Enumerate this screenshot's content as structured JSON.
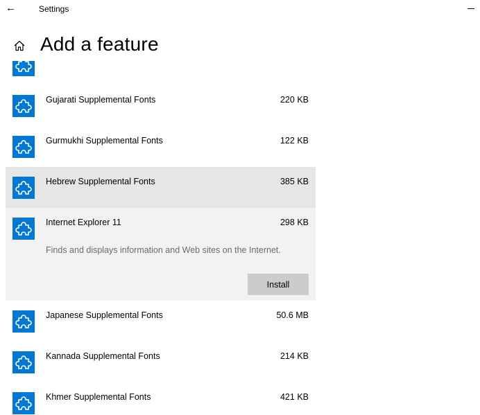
{
  "window": {
    "title": "Settings",
    "back_icon": "arrow-left-icon",
    "minimize_icon": "minimize-icon"
  },
  "page": {
    "title": "Add a feature",
    "home_icon": "home-icon"
  },
  "colors": {
    "accent": "#0078d4",
    "hover_bg": "#e6e6e6",
    "expanded_bg": "#f2f2f2",
    "button_bg": "#cccccc",
    "description_text": "#6b6b6b"
  },
  "features": [
    {
      "name": "",
      "size": "",
      "icon": "puzzle-piece-icon"
    },
    {
      "name": "Gujarati Supplemental Fonts",
      "size": "220 KB",
      "icon": "puzzle-piece-icon"
    },
    {
      "name": "Gurmukhi Supplemental Fonts",
      "size": "122 KB",
      "icon": "puzzle-piece-icon"
    },
    {
      "name": "Hebrew Supplemental Fonts",
      "size": "385 KB",
      "icon": "puzzle-piece-icon",
      "state": "hover"
    },
    {
      "name": "Internet Explorer 11",
      "size": "298 KB",
      "icon": "puzzle-piece-icon",
      "state": "expanded",
      "description": "Finds and displays information and Web sites on the Internet.",
      "install_label": "Install"
    },
    {
      "name": "Japanese Supplemental Fonts",
      "size": "50.6 MB",
      "icon": "puzzle-piece-icon"
    },
    {
      "name": "Kannada Supplemental Fonts",
      "size": "214 KB",
      "icon": "puzzle-piece-icon"
    },
    {
      "name": "Khmer Supplemental Fonts",
      "size": "421 KB",
      "icon": "puzzle-piece-icon"
    }
  ]
}
